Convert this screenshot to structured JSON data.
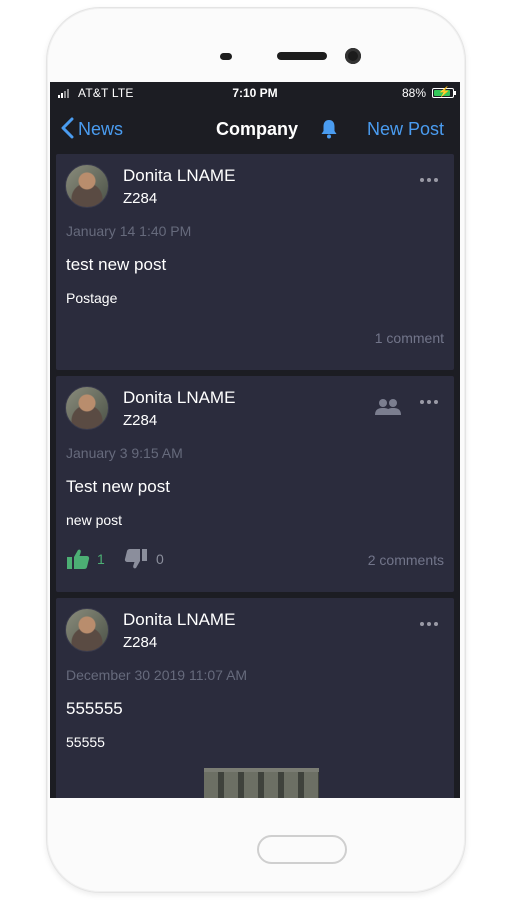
{
  "status_bar": {
    "carrier": "AT&T  LTE",
    "time": "7:10 PM",
    "battery": "88%",
    "battery_level": 0.88
  },
  "nav": {
    "back_label": "News",
    "title": "Company",
    "new_post_label": "New Post"
  },
  "posts": [
    {
      "author": "Donita LNAME",
      "handle": "Z284",
      "timestamp": "January 14 1:40 PM",
      "title": "test new post",
      "body": "Postage",
      "comments": "1 comment"
    },
    {
      "author": "Donita LNAME",
      "handle": "Z284",
      "timestamp": "January 3 9:15 AM",
      "title": "Test new post",
      "body": "new post",
      "likes": "1",
      "dislikes": "0",
      "comments": "2 comments"
    },
    {
      "author": "Donita LNAME",
      "handle": "Z284",
      "timestamp": "December 30 2019 11:07 AM",
      "title": "555555",
      "body": "55555"
    }
  ],
  "colors": {
    "background": "#1c1d23",
    "card": "#2b2c3d",
    "accent": "#4a9cf0",
    "like": "#4caf74"
  }
}
